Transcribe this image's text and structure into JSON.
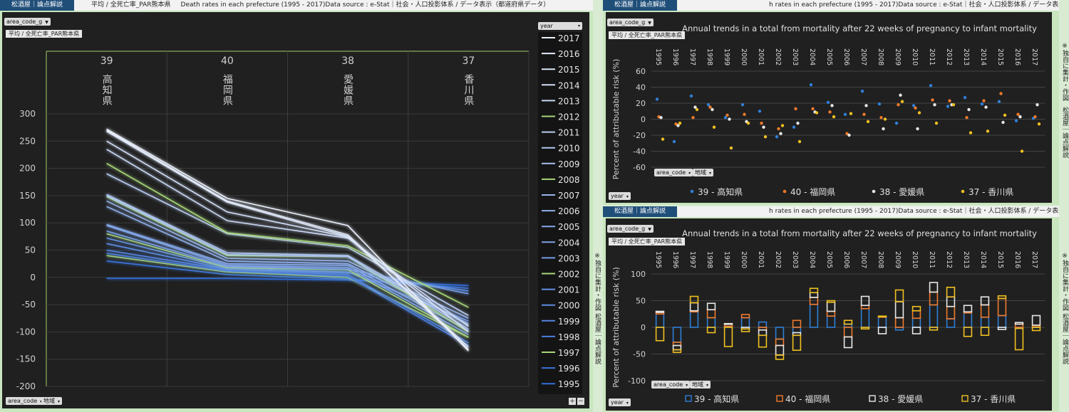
{
  "header": {
    "badge": "松酒屋｜論点解説",
    "left_subtitle": "平均 / 全死亡率_PAR熊本県",
    "left_title": "Death rates in each prefecture (1995 - 2017)Data source : e-Stat｜社会・人口投影体系 / データ表示（都道府県データ）",
    "right_title": "h rates in each prefecture (1995 - 2017)Data source : e-Stat｜社会・人口投影体系 / データ表示（都道府県データ）"
  },
  "controls": {
    "area_code_g": "area_code_g",
    "filter_pill": "平均 / 全死亡率_PAR熊本県",
    "area_code": "area_code",
    "region": "地域",
    "year": "year"
  },
  "side_text": {
    "note": "※独自に集計・作図",
    "brand": "松酒屋｜論点解説"
  },
  "colors": {
    "blue": "#2f7fd8",
    "orange": "#f07a2a",
    "white": "#e8e8e8",
    "yellow": "#f0c020",
    "green_year": "#9ccf6a"
  },
  "chart_data": [
    {
      "type": "line",
      "prefectures": [
        {
          "code": "39",
          "name": "高知県"
        },
        {
          "code": "40",
          "name": "福岡県"
        },
        {
          "code": "38",
          "name": "愛媛県"
        },
        {
          "code": "37",
          "name": "香川県"
        }
      ],
      "ylim": [
        -200,
        300
      ],
      "yticks": [
        300,
        250,
        200,
        150,
        100,
        50,
        0,
        -50,
        -100,
        -150,
        -200
      ],
      "series": [
        {
          "name": "2017",
          "values": [
            272,
            145,
            95,
            -135
          ]
        },
        {
          "name": "2016",
          "values": [
            270,
            140,
            78,
            -132
          ]
        },
        {
          "name": "2015",
          "values": [
            268,
            138,
            75,
            -128
          ]
        },
        {
          "name": "2014",
          "values": [
            250,
            120,
            74,
            -100
          ]
        },
        {
          "name": "2013",
          "values": [
            235,
            104,
            72,
            -90
          ]
        },
        {
          "name": "2012",
          "values": [
            209,
            82,
            58,
            -55
          ]
        },
        {
          "name": "2011",
          "values": [
            190,
            80,
            55,
            -70
          ]
        },
        {
          "name": "2010",
          "values": [
            152,
            45,
            40,
            -88
          ]
        },
        {
          "name": "2009",
          "values": [
            150,
            42,
            38,
            -95
          ]
        },
        {
          "name": "2008",
          "values": [
            148,
            40,
            38,
            -100
          ]
        },
        {
          "name": "2007",
          "values": [
            140,
            35,
            30,
            -75
          ]
        },
        {
          "name": "2006",
          "values": [
            130,
            30,
            25,
            -85
          ]
        },
        {
          "name": "2005",
          "values": [
            97,
            25,
            22,
            -98
          ]
        },
        {
          "name": "2004",
          "values": [
            95,
            22,
            18,
            -105
          ]
        },
        {
          "name": "2003",
          "values": [
            85,
            20,
            15,
            -30
          ]
        },
        {
          "name": "2002",
          "values": [
            80,
            18,
            14,
            -110
          ]
        },
        {
          "name": "2001",
          "values": [
            72,
            17,
            10,
            -80
          ]
        },
        {
          "name": "2000",
          "values": [
            62,
            15,
            8,
            -25
          ]
        },
        {
          "name": "1999",
          "values": [
            50,
            14,
            5,
            -120
          ]
        },
        {
          "name": "1998",
          "values": [
            44,
            12,
            2,
            -125
          ]
        },
        {
          "name": "1997",
          "values": [
            40,
            10,
            0,
            -110
          ]
        },
        {
          "name": "1996",
          "values": [
            30,
            5,
            -3,
            -20
          ]
        },
        {
          "name": "1995",
          "values": [
            -2,
            -2,
            -5,
            -15
          ]
        }
      ],
      "legend_title": "year"
    },
    {
      "type": "scatter",
      "title": "Annual trends in a total from mortality after 22 weeks of pregnancy to infant mortality",
      "ylabel": "Percent of attributable risk (%)",
      "ylim": [
        -60,
        60
      ],
      "yticks": [
        60,
        40,
        20,
        0,
        -20,
        -40,
        -60
      ],
      "categories": [
        "1995",
        "1996",
        "1997",
        "1998",
        "1999",
        "2000",
        "2001",
        "2002",
        "2003",
        "2004",
        "2005",
        "2006",
        "2007",
        "2008",
        "2009",
        "2010",
        "2011",
        "2012",
        "2013",
        "2014",
        "2015",
        "2016",
        "2017"
      ],
      "series": [
        {
          "name": "39 - 高知県",
          "values": [
            25,
            -28,
            29,
            18,
            2,
            18,
            10,
            -22,
            -10,
            43,
            21,
            6,
            35,
            19,
            -5,
            17,
            42,
            16,
            27,
            19,
            22,
            -2,
            1
          ]
        },
        {
          "name": "40 - 福岡県",
          "values": [
            3,
            -6,
            2,
            15,
            5,
            6,
            -5,
            -12,
            13,
            13,
            9,
            -18,
            6,
            2,
            18,
            14,
            24,
            23,
            2,
            23,
            32,
            6,
            3
          ]
        },
        {
          "name": "38 - 愛媛県",
          "values": [
            2,
            -8,
            15,
            12,
            0,
            -3,
            -10,
            -18,
            -5,
            9,
            17,
            -20,
            17,
            -12,
            30,
            -12,
            18,
            18,
            12,
            15,
            -4,
            3,
            18
          ]
        },
        {
          "name": "37 - 香川県",
          "values": [
            -25,
            -5,
            12,
            -10,
            -36,
            -5,
            -22,
            -8,
            -28,
            8,
            3,
            7,
            -3,
            0,
            22,
            8,
            -5,
            18,
            -17,
            -15,
            5,
            -40,
            -6
          ]
        }
      ]
    },
    {
      "type": "bar",
      "title": "Annual trends in a total from mortality after 22 weeks of pregnancy to infant mortality",
      "ylabel": "Percent of attributable risk (%)",
      "ylim": [
        -100,
        100
      ],
      "yticks": [
        100,
        50,
        0,
        -50,
        -100
      ],
      "categories": [
        "1995",
        "1996",
        "1997",
        "1998",
        "1999",
        "2000",
        "2001",
        "2002",
        "2003",
        "2004",
        "2005",
        "2006",
        "2007",
        "2008",
        "2009",
        "2010",
        "2011",
        "2012",
        "2013",
        "2014",
        "2015",
        "2016",
        "2017"
      ],
      "series": [
        {
          "name": "39 - 高知県",
          "values": [
            25,
            -28,
            29,
            18,
            2,
            18,
            10,
            -22,
            -10,
            43,
            21,
            6,
            35,
            19,
            -5,
            17,
            42,
            16,
            27,
            19,
            22,
            -2,
            1
          ]
        },
        {
          "name": "40 - 福岡県",
          "values": [
            3,
            -6,
            2,
            15,
            5,
            6,
            -5,
            -12,
            13,
            13,
            9,
            -18,
            6,
            2,
            18,
            14,
            24,
            23,
            2,
            23,
            32,
            6,
            3
          ]
        },
        {
          "name": "38 - 愛媛県",
          "values": [
            2,
            -8,
            15,
            12,
            0,
            -3,
            -10,
            -18,
            -5,
            9,
            17,
            -20,
            17,
            -12,
            30,
            -12,
            18,
            18,
            12,
            15,
            -4,
            3,
            18
          ]
        },
        {
          "name": "37 - 香川県",
          "values": [
            -25,
            -5,
            12,
            -10,
            -36,
            -5,
            -22,
            -8,
            -28,
            8,
            3,
            7,
            -3,
            0,
            22,
            8,
            -5,
            18,
            -17,
            -15,
            5,
            -40,
            -6
          ]
        }
      ]
    }
  ]
}
